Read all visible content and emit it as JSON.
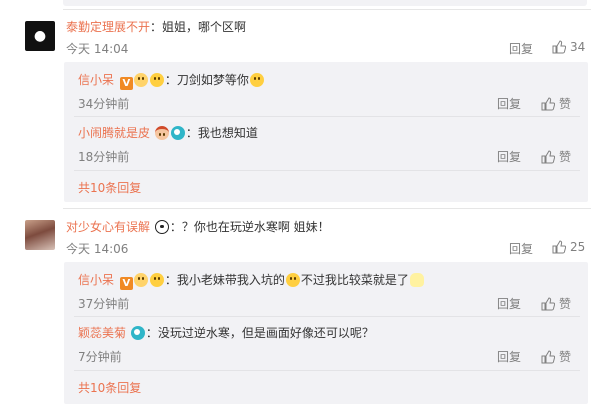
{
  "comments": [
    {
      "username": "泰勤定理展不开",
      "text": "：姐姐，哪个区啊",
      "time": "今天 14:04",
      "reply_label": "回复",
      "likes": "34",
      "replies": [
        {
          "username": "信小呆",
          "text": "：刀剑如梦等你",
          "time": "34分钟前",
          "reply_label": "回复",
          "like_label": "赞"
        },
        {
          "username": "小闹腾就是皮",
          "text": "：我也想知道",
          "time": "18分钟前",
          "reply_label": "回复",
          "like_label": "赞"
        }
      ],
      "more_label": "共10条回复"
    },
    {
      "username": "对少女心有误解",
      "text": "：？你也在玩逆水寒啊  姐妹！",
      "time": "今天 14:06",
      "reply_label": "回复",
      "likes": "25",
      "replies": [
        {
          "username": "信小呆",
          "text_a": "：我小老妹带我入坑的",
          "text_b": "不过我比较菜就是了",
          "time": "37分钟前",
          "reply_label": "回复",
          "like_label": "赞"
        },
        {
          "username": "颖蕊美菊",
          "text": "：没玩过逆水寒，但是画面好像还可以呢？",
          "time": "7分钟前",
          "reply_label": "回复",
          "like_label": "赞"
        }
      ],
      "more_label": "共10条回复"
    }
  ],
  "colors": {
    "link": "#eb7350",
    "meta": "#808080",
    "panel": "#f2f2f5"
  }
}
